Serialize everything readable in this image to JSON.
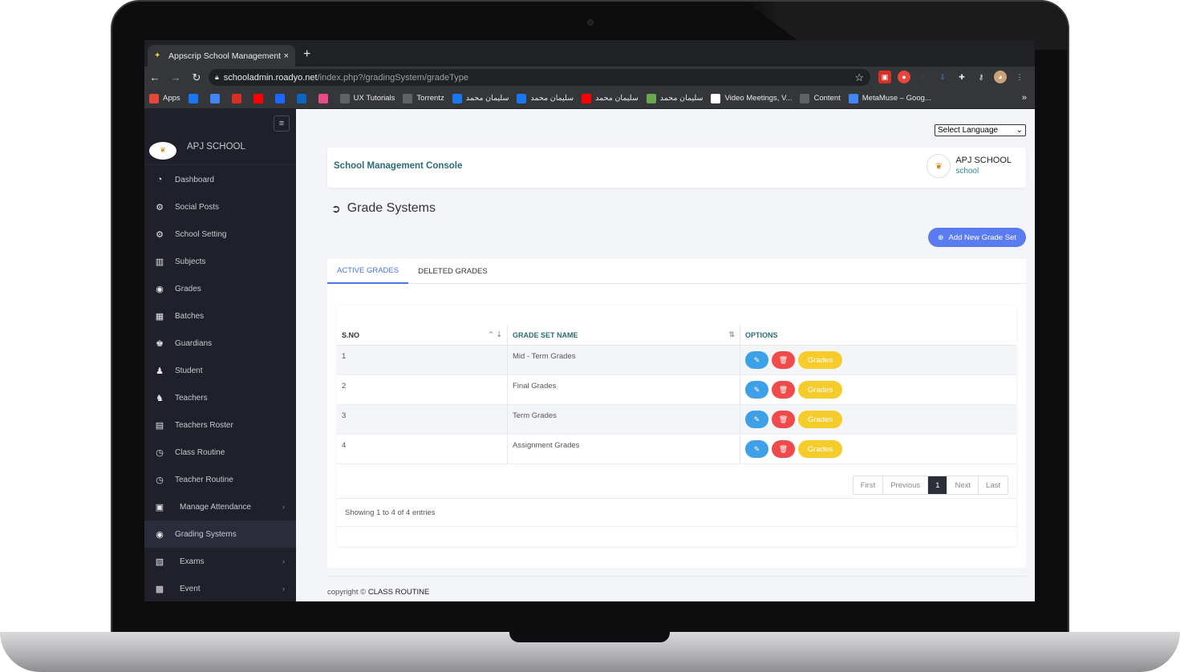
{
  "browser": {
    "tab_title": "Appscrip School Management",
    "tab_close": "×",
    "new_tab": "+",
    "url_host": "schooladmin.roadyo.net",
    "url_path": "/index.php?/gradingSystem/gradeType",
    "bookmarks": [
      {
        "label": "Apps",
        "color": "#e8453c"
      },
      {
        "label": "",
        "color": "#1877f2"
      },
      {
        "label": "",
        "color": "#4285f4"
      },
      {
        "label": "",
        "color": "#d93025"
      },
      {
        "label": "",
        "color": "#ff0000"
      },
      {
        "label": "",
        "color": "#1769ff"
      },
      {
        "label": "",
        "color": "#0a66c2"
      },
      {
        "label": "",
        "color": "#ea4c89"
      },
      {
        "label": "UX Tutorials",
        "color": "#5f6368"
      },
      {
        "label": "Torrentz",
        "color": "#5f6368"
      },
      {
        "label": "سليمان محمد",
        "color": "#1877f2"
      },
      {
        "label": "سليمان محمد",
        "color": "#1877f2"
      },
      {
        "label": "سليمان محمد",
        "color": "#ff0000"
      },
      {
        "label": "سليمان محمد",
        "color": "#6aa84f"
      },
      {
        "label": "Video Meetings, V...",
        "color": "#ffffff"
      },
      {
        "label": "Content",
        "color": "#5f6368"
      },
      {
        "label": "MetaMuse – Goog...",
        "color": "#4285f4"
      }
    ],
    "more": "»"
  },
  "sidebar": {
    "school_name": "APJ SCHOOL",
    "items": [
      {
        "label": "Dashboard",
        "icon": "dashboard-icon",
        "glyph": "◔"
      },
      {
        "label": "Social Posts",
        "icon": "cogs-icon",
        "glyph": "⚙"
      },
      {
        "label": "School Setting",
        "icon": "cogs-icon",
        "glyph": "⚙"
      },
      {
        "label": "Subjects",
        "icon": "book-icon",
        "glyph": "▥"
      },
      {
        "label": "Grades",
        "icon": "circle-dot-icon",
        "glyph": "◉"
      },
      {
        "label": "Batches",
        "icon": "batch-icon",
        "glyph": "▦"
      },
      {
        "label": "Guardians",
        "icon": "guardian-icon",
        "glyph": "♚"
      },
      {
        "label": "Student",
        "icon": "student-icon",
        "glyph": "♟"
      },
      {
        "label": "Teachers",
        "icon": "teacher-icon",
        "glyph": "♞"
      },
      {
        "label": "Teachers Roster",
        "icon": "roster-icon",
        "glyph": "▤"
      },
      {
        "label": "Class Routine",
        "icon": "clock-icon",
        "glyph": "◷"
      },
      {
        "label": "Teacher Routine",
        "icon": "clock-icon",
        "glyph": "◷"
      },
      {
        "label": "Manage Attendance",
        "icon": "attendance-icon",
        "glyph": "▣",
        "chevron": "›"
      },
      {
        "label": "Grading Systems",
        "icon": "circle-dot-icon",
        "glyph": "◉"
      },
      {
        "label": "Exams",
        "icon": "exam-icon",
        "glyph": "▧",
        "chevron": "›"
      },
      {
        "label": "Event",
        "icon": "event-icon",
        "glyph": "▩",
        "chevron": "›"
      }
    ]
  },
  "header": {
    "language_select": "Select Language",
    "console_title": "School Management Console",
    "school_name": "APJ SCHOOL",
    "school_sub": "school"
  },
  "page": {
    "title": "Grade Systems",
    "add_button": "Add New Grade Set",
    "tabs": [
      "ACTIVE GRADES",
      "DELETED GRADES"
    ]
  },
  "table": {
    "columns": [
      "S.NO",
      "GRADE SET NAME",
      "OPTIONS"
    ],
    "rows": [
      {
        "sno": "1",
        "name": "Mid - Term Grades"
      },
      {
        "sno": "2",
        "name": "Final Grades"
      },
      {
        "sno": "3",
        "name": "Term Grades"
      },
      {
        "sno": "4",
        "name": "Assignment Grades"
      }
    ],
    "grades_button": "Grades",
    "pagination": [
      "First",
      "Previous",
      "1",
      "Next",
      "Last"
    ],
    "info": "Showing 1 to 4 of 4 entries"
  },
  "footer": {
    "prefix": "copyright ©",
    "text": "CLASS ROUTINE"
  },
  "colors": {
    "sidebar_bg": "#1f2029",
    "accent_blue": "#5b7cf0",
    "edit_blue": "#3ea0e6",
    "delete_red": "#f04a4a",
    "grades_yellow": "#f5cc2c",
    "console_teal": "#2b6c74"
  }
}
